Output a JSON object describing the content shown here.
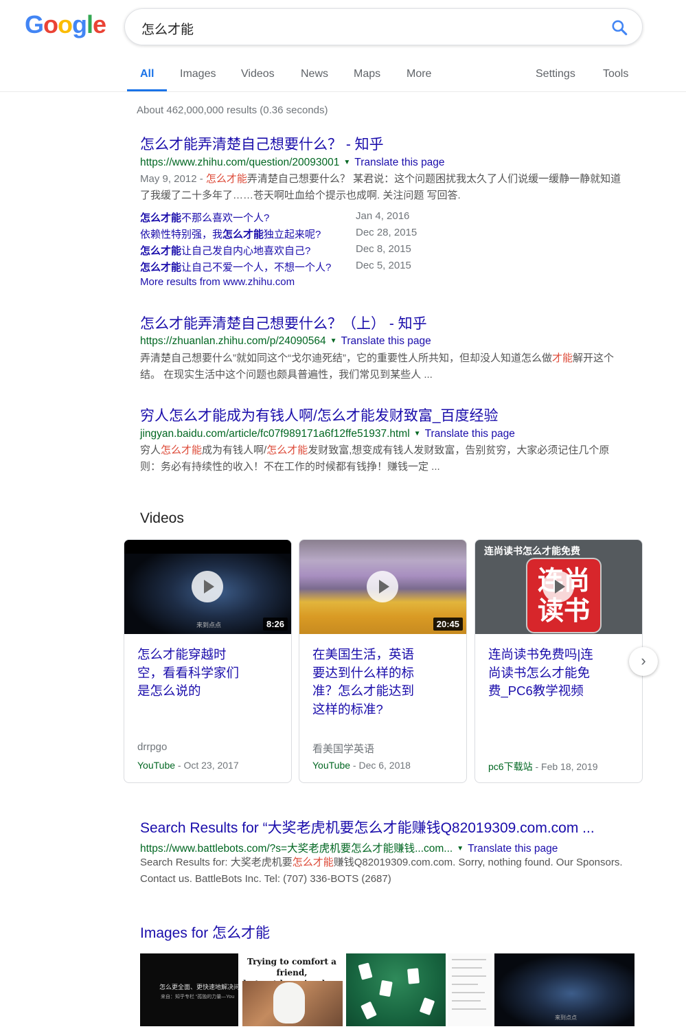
{
  "logo": {
    "letters": [
      "G",
      "o",
      "o",
      "g",
      "l",
      "e"
    ],
    "colors": [
      "#4285f4",
      "#ea4335",
      "#fbbc05",
      "#4285f4",
      "#34a853",
      "#ea4335"
    ]
  },
  "search": {
    "query": "怎么才能"
  },
  "tabs": {
    "all": "All",
    "images": "Images",
    "videos": "Videos",
    "news": "News",
    "maps": "Maps",
    "more": "More",
    "settings": "Settings",
    "tools": "Tools"
  },
  "stats": "About 462,000,000 results (0.36 seconds)",
  "results": [
    {
      "title": "怎么才能弄清楚自己想要什么？ - 知乎",
      "url": "https://www.zhihu.com/question/20093001",
      "translate": "Translate this page",
      "snippet": {
        "date": "May 9, 2012 - ",
        "hl": "怎么才能",
        "rest": "弄清楚自己想要什么？ 某君说：这个问题困扰我太久了人们说缓一缓静一静就知道了我缓了二十多年了……苍天啊吐血给个提示也成啊. 关注问题 写回答."
      },
      "sitelinks": [
        {
          "bold": "怎么才能",
          "text": "不那么喜欢一个人?",
          "date": "Jan 4, 2016"
        },
        {
          "pre": "依赖性特别强，我",
          "bold": "怎么才能",
          "text": "独立起来呢?",
          "date": "Dec 28, 2015"
        },
        {
          "bold": "怎么才能",
          "text": "让自己发自内心地喜欢自己?",
          "date": "Dec 8, 2015"
        },
        {
          "bold": "怎么才能",
          "text": "让自己不爱一个人，不想一个人?",
          "date": "Dec 5, 2015"
        }
      ],
      "more_results": "More results from www.zhihu.com"
    },
    {
      "title": "怎么才能弄清楚自己想要什么？（上） - 知乎",
      "url": "https://zhuanlan.zhihu.com/p/24090564",
      "translate": "Translate this page",
      "snippet": {
        "pre": "弄清楚自己想要什么”就如同这个“戈尔迪死结”，它的重要性人所共知，但却没人知道怎么做",
        "hl": "才能",
        "rest": "解开这个结。 在现实生活中这个问题也颇具普遍性，我们常见到某些人 ..."
      }
    },
    {
      "title": "穷人怎么才能成为有钱人啊/怎么才能发财致富_百度经验",
      "url": "jingyan.baidu.com/article/fc07f989171a6f12ffe51937.html",
      "translate": "Translate this page",
      "snippet": {
        "pre": "穷人",
        "hl": "怎么才能",
        "mid": "成为有钱人啊/",
        "hl2": "怎么才能",
        "rest": "发财致富,想变成有钱人发财致富，告别贫穷，大家必须记住几个原则：务必有持续性的收入！不在工作的时候都有钱挣！赚钱一定 ..."
      }
    }
  ],
  "videos": {
    "heading": "Videos",
    "items": [
      {
        "title": "怎么才能穿越时空，看看科学家们是怎么说的",
        "duration": "8:26",
        "channel": "drrpgo",
        "source": "YouTube",
        "date": " - Oct 23, 2017",
        "thumb_caption": "来到点点"
      },
      {
        "title": "在美国生活，英语要达到什么样的标准？怎么才能达到这样的标准?",
        "duration": "20:45",
        "channel": "看美国学英语",
        "source": "YouTube",
        "date": " - Dec 6, 2018"
      },
      {
        "title": "连尚读书免费吗|连尚读书怎么才能免费_PC6教学视频",
        "channel": "",
        "source": "pc6下载站",
        "date": " - Feb 18, 2019",
        "thumb_header": "连尚读书怎么才能免费",
        "thumb_logo": "连尚读书"
      }
    ]
  },
  "result4": {
    "title": "Search Results for “大奖老虎机要怎么才能赚钱Q82019309.com.com ...",
    "url": "https://www.battlebots.com/?s=大奖老虎机要怎么才能赚钱...com...",
    "translate": "Translate this page",
    "snippet": {
      "pre": "Search Results for: 大奖老虎机要",
      "hl": "怎么才能",
      "rest": "赚钱Q82019309.com.com. Sorry, nothing found. Our Sponsors. Contact us. BattleBots Inc. Tel: (707) 336-BOTS (2687)"
    }
  },
  "images": {
    "heading": "Images for 怎么才能",
    "img1_line1": "怎么更全面、更快速地解决问",
    "img1_line2": "来自：知乎专栏 “孤独的力量—You",
    "img2_line1": "Trying to comfort a friend,",
    "img2_line2": "but not knowing how",
    "img5_caption": "来到点点"
  }
}
